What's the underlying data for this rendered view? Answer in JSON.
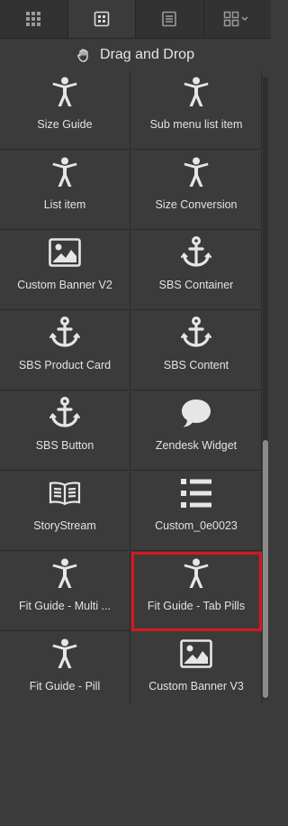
{
  "tabs": [
    {
      "name": "apps-grid-icon"
    },
    {
      "name": "blocks-icon",
      "active": true
    },
    {
      "name": "layers-list-icon"
    },
    {
      "name": "view-options-icon"
    }
  ],
  "panel": {
    "title": "Drag and Drop",
    "icon": "hand-icon"
  },
  "blocks": [
    {
      "label": "Size Guide",
      "icon": "person-icon"
    },
    {
      "label": "Sub menu list item",
      "icon": "person-icon"
    },
    {
      "label": "List item",
      "icon": "person-icon"
    },
    {
      "label": "Size Conversion",
      "icon": "person-icon"
    },
    {
      "label": "Custom Banner V2",
      "icon": "image-icon"
    },
    {
      "label": "SBS Container",
      "icon": "anchor-icon"
    },
    {
      "label": "SBS Product Card",
      "icon": "anchor-icon"
    },
    {
      "label": "SBS Content",
      "icon": "anchor-icon"
    },
    {
      "label": "SBS Button",
      "icon": "anchor-icon"
    },
    {
      "label": "Zendesk Widget",
      "icon": "speech-bubble-icon"
    },
    {
      "label": "StoryStream",
      "icon": "book-icon"
    },
    {
      "label": "Custom_0e0023",
      "icon": "list-icon"
    },
    {
      "label": "Fit Guide - Multi ...",
      "icon": "person-icon"
    },
    {
      "label": "Fit Guide - Tab Pills",
      "icon": "person-icon",
      "selected": true
    },
    {
      "label": "Fit Guide - Pill",
      "icon": "person-icon"
    },
    {
      "label": "Custom Banner V3",
      "icon": "image-icon"
    }
  ],
  "colors": {
    "background": "#3b3b3b",
    "icon": "#e6e6e6",
    "selection": "#d6181f"
  }
}
